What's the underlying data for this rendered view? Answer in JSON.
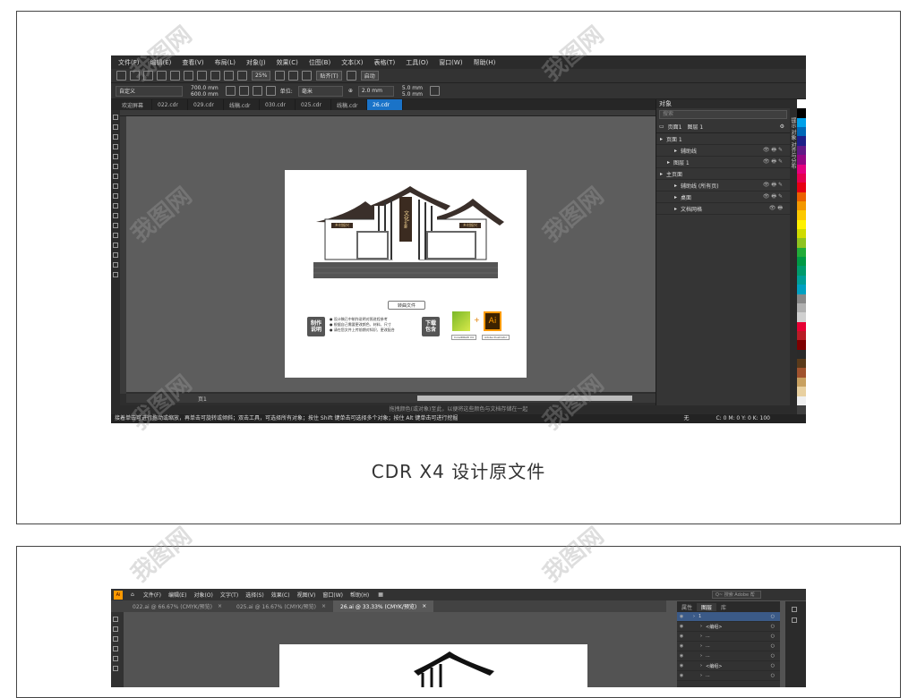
{
  "caption": "CDR X4 设计原文件",
  "cdr": {
    "menu": [
      "文件(F)",
      "编辑(E)",
      "查看(V)",
      "布局(L)",
      "对象(J)",
      "效果(C)",
      "位图(B)",
      "文本(X)",
      "表格(T)",
      "工具(O)",
      "窗口(W)",
      "帮助(H)"
    ],
    "toolbar": {
      "zoom": "25%",
      "snap": "贴齐(T)",
      "launch": "启动"
    },
    "propbar": {
      "preset": "自定义",
      "width": "700.0 mm",
      "height": "600.0 mm",
      "unit_label": "单位:",
      "unit": "毫米",
      "nudge": "2.0 mm",
      "dup_x": "5.0 mm",
      "dup_y": "5.0 mm"
    },
    "tabs": [
      {
        "label": "欢迎屏幕",
        "active": false
      },
      {
        "label": "022.cdr",
        "active": false
      },
      {
        "label": "029.cdr",
        "active": false
      },
      {
        "label": "线稿.cdr",
        "active": false
      },
      {
        "label": "030.cdr",
        "active": false
      },
      {
        "label": "025.cdr",
        "active": false
      },
      {
        "label": "线稿.cdr",
        "active": false
      },
      {
        "label": "26.cdr",
        "active": true
      }
    ],
    "artwork": {
      "title_sign": "文化",
      "title_sign_sub": "长廊",
      "left_sign": "乡村振兴",
      "right_sign": "乡村振兴",
      "source_button": "转曲文件",
      "badge_make": "制作\n说明",
      "notes": [
        "● 设计稿已中制作说明对照进程参考",
        "● 根据自己需要更改颜色、材料、尺寸",
        "● 请在您文件上传前期对知识、更改配合"
      ],
      "badge_download": "下载\n包含",
      "plus": "+",
      "ai_label": "Ai",
      "cdr_caption": "CorelDRAW X4",
      "ai_caption": "Adobe Illustrator"
    },
    "page_nav": "页1",
    "status_hint": "拖拽颜色(或对象)至此，以便将这些颜色与文档存储在一起",
    "status_text": "接着单击可进行拖动或缩放，再单击可旋转或倾斜；双击工具，可选择所有对象；按住 Shift 键单击可选择多个对象；按住 Alt 键单击可进行挖掘",
    "color_readout": "C: 0 M: 0 Y: 0 K: 100",
    "fill_none": "无",
    "objects_panel": {
      "title": "对象",
      "search_placeholder": "搜索",
      "page_label": "页面1",
      "layer_label": "图层 1",
      "rows": [
        {
          "label": "页面 1",
          "indent": 0,
          "eyes": ""
        },
        {
          "label": "辅助线",
          "indent": 2,
          "eyes": "👁 🖶 ✎"
        },
        {
          "label": "图层 1",
          "indent": 1,
          "eyes": "👁 🖶 ✎"
        },
        {
          "label": "主页面",
          "indent": 0,
          "eyes": ""
        },
        {
          "label": "辅助线 (所有页)",
          "indent": 2,
          "eyes": "👁 🖶 ✎"
        },
        {
          "label": "桌面",
          "indent": 2,
          "eyes": "👁 🖶 ✎"
        },
        {
          "label": "文档网格",
          "indent": 2,
          "eyes": "👁 🖶"
        }
      ]
    },
    "dock_labels": "提示 对象 对齐与分布",
    "palette": [
      "#ffffff",
      "#000000",
      "#00a0e9",
      "#0068b7",
      "#1d2088",
      "#601986",
      "#920783",
      "#e4007f",
      "#e5004f",
      "#e60012",
      "#eb6100",
      "#f39800",
      "#fcc800",
      "#fff100",
      "#cfdb00",
      "#8fc31f",
      "#22ac38",
      "#009944",
      "#009b6b",
      "#009e96",
      "#00a0c1",
      "#888888",
      "#b0b0b0",
      "#d0d0d0",
      "#e60033",
      "#b81c25",
      "#7d0000",
      "#2a2a2a",
      "#5a3a1a",
      "#a0522d",
      "#c8a060",
      "#e8d0a0",
      "#f0f0f0",
      "#404040"
    ]
  },
  "ai": {
    "logo": "Ai",
    "menu": [
      "文件(F)",
      "编辑(E)",
      "对象(O)",
      "文字(T)",
      "选择(S)",
      "效果(C)",
      "视图(V)",
      "窗口(W)",
      "帮助(H)"
    ],
    "search_placeholder": "Q~ 搜索 Adobe 帮",
    "tabs": [
      {
        "label": "022.ai @ 66.67% (CMYK/预览)",
        "active": false
      },
      {
        "label": "025.ai @ 16.67% (CMYK/预览)",
        "active": false
      },
      {
        "label": "26.ai @ 33.33% (CMYK/预览)",
        "active": true
      }
    ],
    "panel_tabs": [
      "属性",
      "图层",
      "库"
    ],
    "layer_rows": [
      {
        "label": "1",
        "sel": true
      },
      {
        "label": "<编组>",
        "sel": false
      },
      {
        "label": "...",
        "sel": false
      },
      {
        "label": "...",
        "sel": false
      },
      {
        "label": "...",
        "sel": false
      },
      {
        "label": "<编组>",
        "sel": false
      },
      {
        "label": "...",
        "sel": false
      }
    ]
  },
  "watermark": "我图网"
}
